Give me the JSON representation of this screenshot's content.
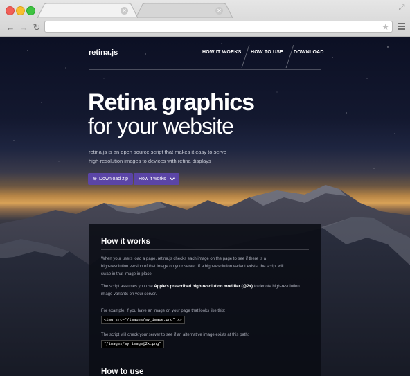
{
  "browser": {
    "tabs": [
      "",
      ""
    ],
    "address": ""
  },
  "site": {
    "brand": "retina.js",
    "nav": [
      "HOW IT WORKS",
      "HOW TO USE",
      "DOWNLOAD"
    ],
    "hero": {
      "title_bold": "Retina graphics",
      "title_light": "for your website",
      "lead_line1": "retina.js is an open source script that makes it easy to serve",
      "lead_line2": "high-resolution images to devices with retina displays",
      "button_download": "Download zip",
      "button_how": "How it works"
    },
    "section": {
      "heading": "How it works",
      "p1_line1": "When your users load a page, retina.js checks each image on the page to see if there is a",
      "p1_line2": "high-resolution version of that image on your server. If a high-resolution variant exists, the script will",
      "p1_line3": "swap in that image in-place.",
      "p2_pre": "The script assumes you use ",
      "p2_bold": "Apple's prescribed high-resolution modifier (@2x)",
      "p2_post": " to denote high-resolution",
      "p2_line2": "image variants on your server.",
      "p3": "For example, if you have an image on your page that looks like this:",
      "code1": "<img src=\"/images/my_image.png\" />",
      "p4": "The script will check your server to see if an alternative image exists at this path:",
      "code2": "\"/images/my_image@2x.png\"",
      "heading2": "How to use"
    }
  },
  "colors": {
    "button": "#5b45a6",
    "sky_top": "#0c1024",
    "horizon_glow": "#d9a257"
  },
  "icons": {
    "download": "download-icon",
    "chevron": "chevron-down-icon"
  }
}
